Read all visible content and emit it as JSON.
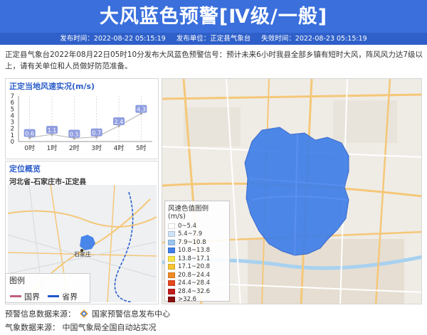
{
  "header": {
    "title": "大风蓝色预警[Ⅳ级/一般]",
    "issue_time": "发布时间：2022-08-22 05:15:19",
    "issuer": "发布单位：正定县气象台",
    "expire_time": "失效时间：2022-08-23 05:15:19"
  },
  "description": "正定县气象台2022年08月22日05时10分发布大风蓝色预警信号：预计未来6小时我县全部乡镇有短时大风，阵风风力达7级以上，请有关单位和人员做好防范准备。",
  "wind_panel": {
    "title": "正定当地风速实况(m/s)"
  },
  "chart_data": {
    "type": "line",
    "title": "正定当地风速实况(m/s)",
    "categories": [
      "0时",
      "1时",
      "2时",
      "3时",
      "4时",
      "5时"
    ],
    "y_ticks": [
      "0",
      "1",
      "2",
      "3",
      "4",
      "5",
      "6",
      "7"
    ],
    "ylim": [
      0,
      7
    ],
    "series": [
      {
        "values": [
          0.6,
          1.1,
          0.5,
          0.7,
          2.4,
          4.3
        ]
      }
    ],
    "data_labels": [
      "0.6",
      "1.1",
      "0.5",
      "0.7",
      "2.4",
      "4.3"
    ],
    "grid": "vertical dashed",
    "line_color": "#bdbdbd",
    "label_color": "#8f9de0"
  },
  "location_panel": {
    "title": "定位概览",
    "subtitle": "河北省-石家庄市-正定县",
    "city_label": "石家庄"
  },
  "mini_legend": {
    "title": "图例",
    "items": [
      {
        "label": "国界",
        "color": "#c0607a"
      },
      {
        "label": "省界",
        "color": "#1f57c9"
      }
    ]
  },
  "wind_legend": {
    "title": "风速色值图例 (m/s)",
    "items": [
      {
        "label": "0~5.4",
        "color": "#ffffff"
      },
      {
        "label": "5.4~7.9",
        "color": "#cfe3f7"
      },
      {
        "label": "7.9~10.8",
        "color": "#9cc6f0"
      },
      {
        "label": "10.8~13.8",
        "color": "#3f7fe8"
      },
      {
        "label": "13.8~17.1",
        "color": "#f9e64a"
      },
      {
        "label": "17.1~20.8",
        "color": "#f7c431"
      },
      {
        "label": "20.8~24.4",
        "color": "#f08a24"
      },
      {
        "label": "24.4~28.4",
        "color": "#e5471f"
      },
      {
        "label": "28.4~32.6",
        "color": "#c21d1d"
      },
      {
        "label": ">32.6",
        "color": "#8a1010"
      }
    ]
  },
  "footer": {
    "warning_source_label": "预警信息数据来源：",
    "warning_source": "国家预警信息发布中心",
    "weather_source_label": "气象数据来源：",
    "weather_source": "中国气象局全国自动站实况"
  },
  "colors": {
    "header_bg": "#3a6fdc",
    "warning_area": "#3f7fe8"
  }
}
